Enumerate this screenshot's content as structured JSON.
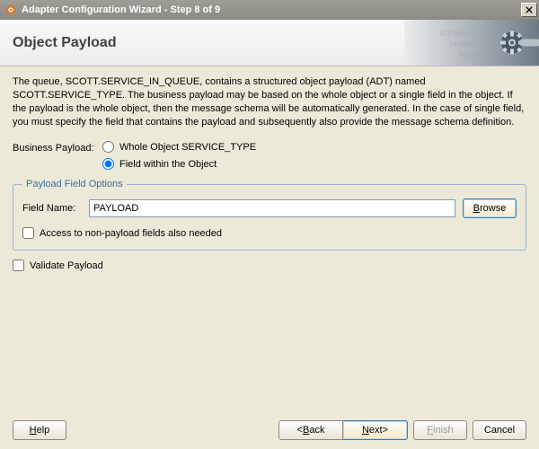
{
  "window": {
    "title": "Adapter Configuration Wizard - Step 8 of 9"
  },
  "header": {
    "title": "Object Payload"
  },
  "description": "The queue, SCOTT.SERVICE_IN_QUEUE, contains a structured object payload (ADT) named SCOTT.SERVICE_TYPE. The business payload may be based on the whole object or a single field in the object. If the payload is the whole object, then the message schema will be automatically generated. In the case of single field, you must specify the field that contains the payload and subsequently also provide the message schema definition.",
  "business_payload": {
    "label": "Business Payload:",
    "options": {
      "whole": {
        "prefix": "W",
        "rest": "hole Object SERVICE_TYPE",
        "selected": false
      },
      "field": {
        "prefix": "F",
        "rest": "ield within the Object",
        "selected": true
      }
    }
  },
  "fieldset": {
    "legend": "Payload Field Options",
    "field_name_label": "Field Name:",
    "field_name_value": "PAYLOAD",
    "browse": {
      "prefix": "B",
      "rest": "rowse"
    },
    "access_non_payload": {
      "prefix": "A",
      "rest": "ccess to non-payload fields also needed",
      "checked": false
    }
  },
  "validate": {
    "prefix": "V",
    "rest": "alidate Payload",
    "checked": false
  },
  "footer": {
    "help": {
      "prefix": "H",
      "rest": "elp"
    },
    "back": {
      "lt": "< ",
      "prefix": "B",
      "rest": "ack"
    },
    "next": {
      "prefix": "N",
      "rest": "ext",
      "gt": " >"
    },
    "finish": {
      "prefix": "F",
      "rest": "inish"
    },
    "cancel": "Cancel"
  }
}
